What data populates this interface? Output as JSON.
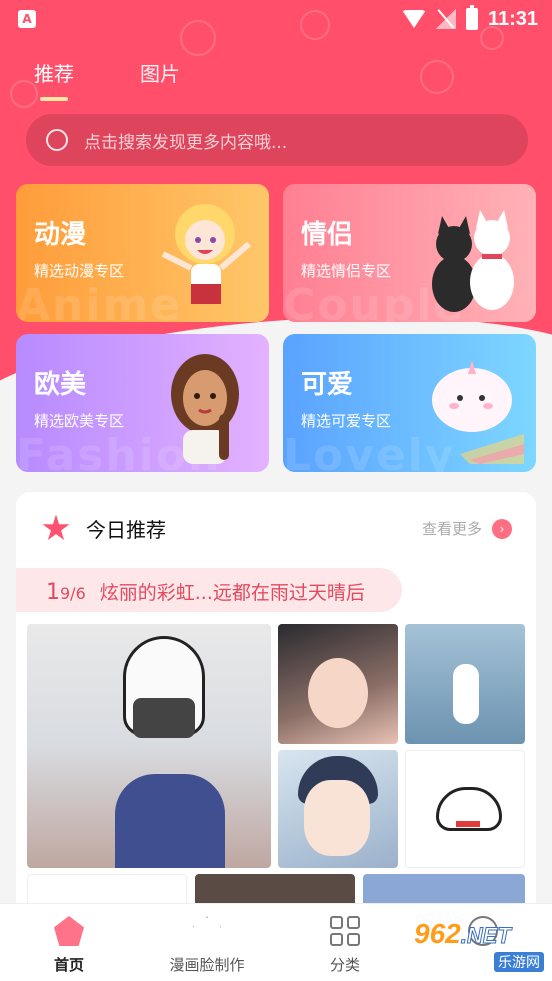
{
  "status_bar": {
    "time": "11:31"
  },
  "top_tabs": [
    {
      "label": "推荐",
      "active": true
    },
    {
      "label": "图片",
      "active": false
    }
  ],
  "search": {
    "placeholder": "点击搜索发现更多内容哦..."
  },
  "categories": [
    {
      "title": "动漫",
      "subtitle": "精选动漫专区",
      "bg_word": "Anime"
    },
    {
      "title": "情侣",
      "subtitle": "精选情侣专区",
      "bg_word": "Couple"
    },
    {
      "title": "欧美",
      "subtitle": "精选欧美专区",
      "bg_word": "Fashion"
    },
    {
      "title": "可爱",
      "subtitle": "精选可爱专区",
      "bg_word": "Lovely"
    }
  ],
  "today": {
    "title": "今日推荐",
    "more": "查看更多",
    "quote": {
      "day": "1",
      "month": "9/6",
      "text": "炫丽的彩虹...远都在雨过天晴后"
    }
  },
  "tabbar": [
    {
      "label": "首页",
      "icon": "home-icon",
      "active": true
    },
    {
      "label": "漫画脸制作",
      "icon": "star-icon",
      "active": false
    },
    {
      "label": "分类",
      "icon": "grid-icon",
      "active": false
    },
    {
      "label": "",
      "icon": "smile-icon",
      "active": false
    }
  ],
  "watermark": {
    "brand": "962",
    "suffix": ".NET",
    "site": "乐游网"
  },
  "colors": {
    "primary": "#ff4f6a",
    "accent": "#ffe7a8"
  }
}
